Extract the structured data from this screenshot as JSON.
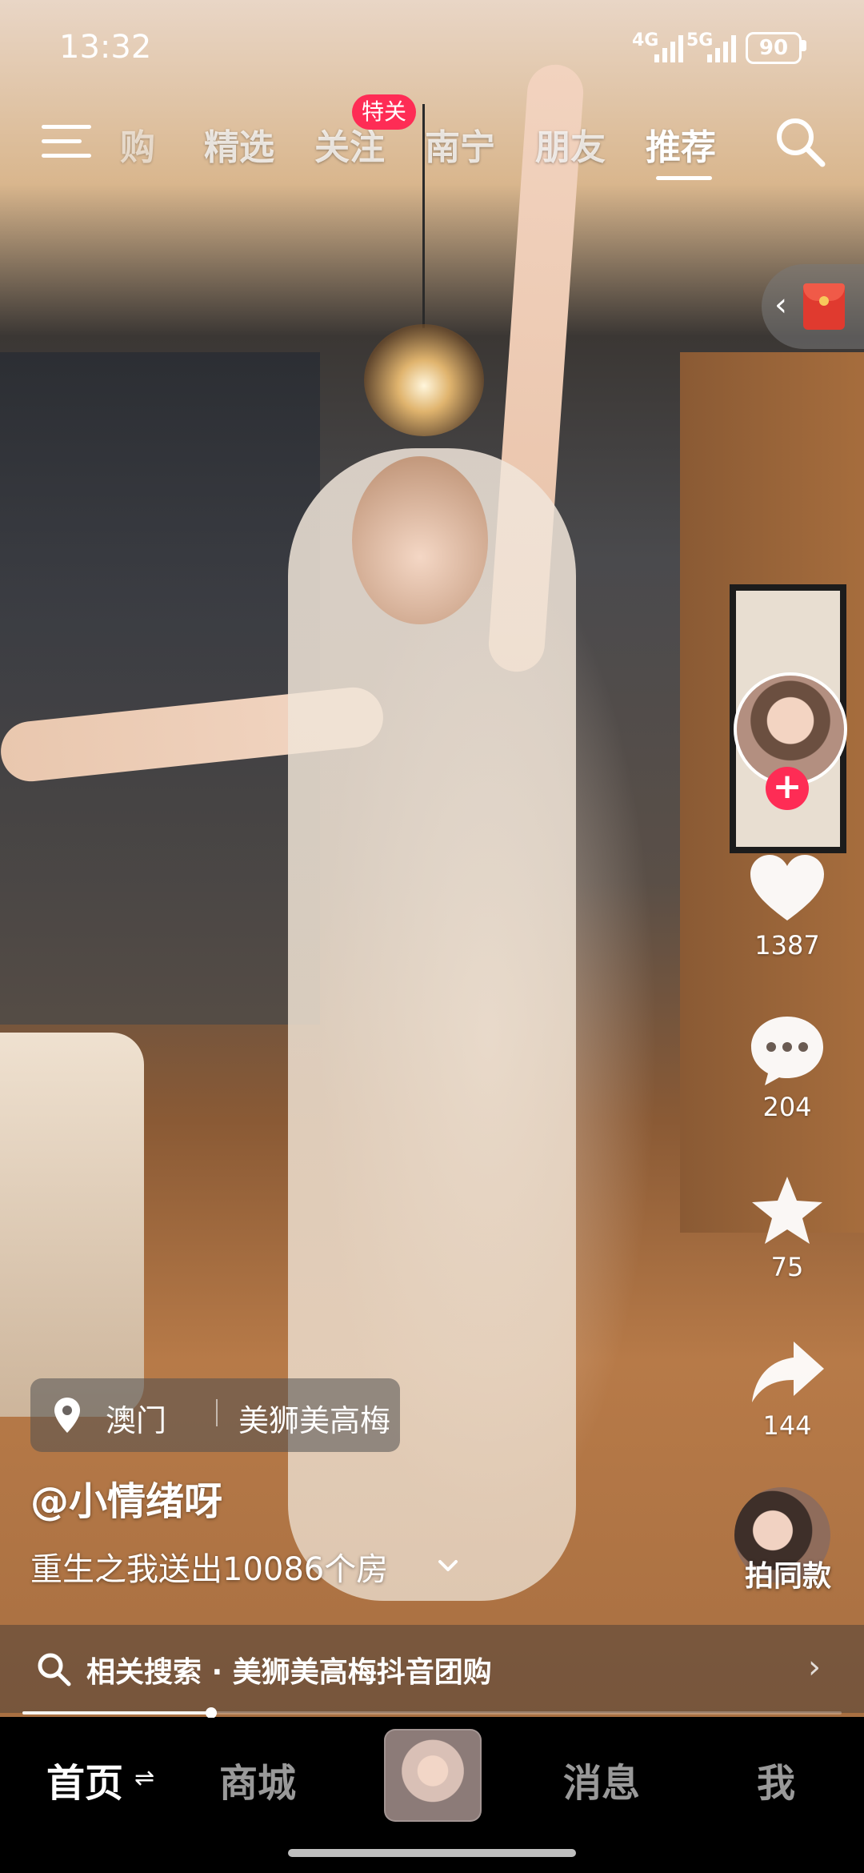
{
  "status_bar": {
    "time": "13:32",
    "network_1": "4G",
    "network_2": "5G",
    "battery": "90"
  },
  "top_tabs": {
    "items": [
      {
        "label": "购",
        "state": "partially-visible"
      },
      {
        "label": "精选"
      },
      {
        "label": "关注"
      },
      {
        "label": "南宁"
      },
      {
        "label": "朋友"
      },
      {
        "label": "推荐",
        "state": "active"
      }
    ],
    "badge": "特关"
  },
  "icons": {
    "menu": "menu-icon",
    "search": "search-icon",
    "red_envelope": "red-envelope-icon",
    "like": "heart-icon",
    "comment": "comment-icon",
    "favorite": "star-icon",
    "share": "share-icon",
    "location": "location-pin-icon"
  },
  "video": {
    "location_city": "澳门",
    "location_venue": "美狮美高梅",
    "author": "@小情绪呀",
    "caption": "重生之我送出10086个房",
    "related_search_label": "相关搜索 · 美狮美高梅抖音团购",
    "progress": 0.23
  },
  "actions": {
    "follow_symbol": "+",
    "like_count": "1387",
    "comment_count": "204",
    "favorite_count": "75",
    "share_count": "144",
    "remix_label": "拍同款"
  },
  "bottom_nav": {
    "home": "首页",
    "home_swap_glyph": "⇌",
    "mall": "商城",
    "messages": "消息",
    "me": "我"
  },
  "colors": {
    "accent": "#fe2c55",
    "background": "#000000"
  }
}
